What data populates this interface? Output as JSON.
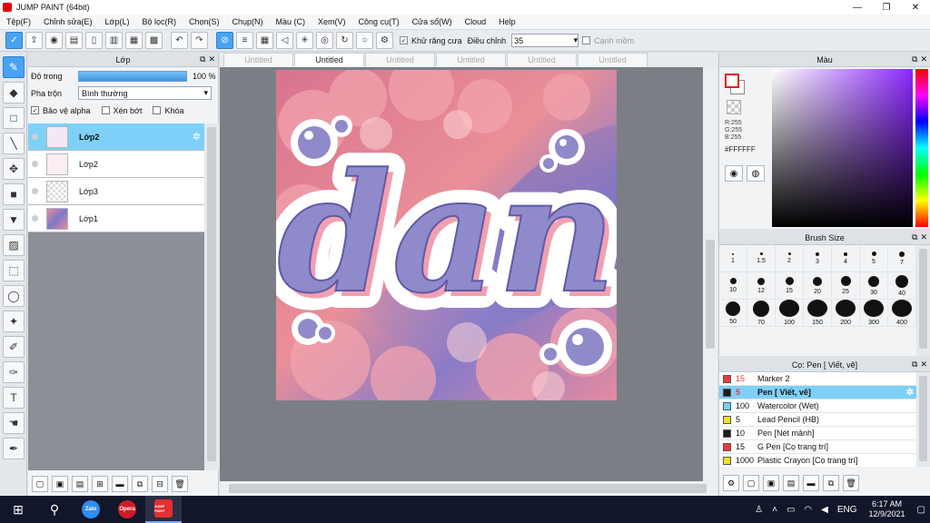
{
  "window": {
    "title": "JUMP PAINT (64bit)",
    "minimize": "—",
    "maximize": "❐",
    "close": "✕"
  },
  "menu": [
    "Tệp(F)",
    "Chỉnh sửa(E)",
    "Lớp(L)",
    "Bộ lọc(R)",
    "Chọn(S)",
    "Chụp(N)",
    "Màu (C)",
    "Xem(V)",
    "Công cụ(T)",
    "Cửa sổ(W)",
    "Cloud",
    "Help"
  ],
  "toolbar": {
    "antialias_check": "✓",
    "antialias_label": "Khử răng cưa",
    "adjust_label": "Điều chỉnh",
    "adjust_value": "35",
    "edge_label": "Cạnh mềm"
  },
  "layers_panel": {
    "title": "Lớp",
    "opacity_label": "Độ trong",
    "opacity_value": "100 %",
    "blend_label": "Pha trộn",
    "blend_value": "Bình thường",
    "protect_alpha_check": "✓",
    "protect_alpha": "Bảo vệ alpha",
    "clip": "Xén bớt",
    "lock": "Khóa",
    "layers": [
      {
        "name": "Lớp2",
        "selected": true
      },
      {
        "name": "Lớp2",
        "selected": false
      },
      {
        "name": "Lớp3",
        "selected": false
      },
      {
        "name": "Lớp1",
        "selected": false
      }
    ]
  },
  "doc_tabs": [
    "Untitled",
    "Untitled",
    "Untitled",
    "Untitled",
    "Untitled",
    "Untitled"
  ],
  "active_tab": 1,
  "canvas": {
    "lettering": "dan"
  },
  "color_panel": {
    "title": "Màu",
    "r": "R:255",
    "g": "G:255",
    "b": "B:255",
    "hex": "#FFFFFF",
    "fg_color": "#ffffff",
    "accent": "#e02020"
  },
  "brush_panel": {
    "title": "Brush Size",
    "sizes": [
      "1",
      "1.5",
      "2",
      "3",
      "4",
      "5",
      "7",
      "10",
      "12",
      "15",
      "20",
      "25",
      "30",
      "40",
      "50",
      "70",
      "100",
      "150",
      "200",
      "300",
      "400"
    ]
  },
  "tool_panel": {
    "title": "Cọ: Pen [ Viết, vẽ]",
    "items": [
      {
        "size": "15",
        "name": "Marker 2",
        "color": "#e83a3a",
        "red": true,
        "selected": false
      },
      {
        "size": "5",
        "name": "Pen [ Viết, vẽ]",
        "color": "#1c1c1c",
        "red": true,
        "selected": true
      },
      {
        "size": "100",
        "name": "Watercolor (Wet)",
        "color": "#6fd3f5",
        "red": false,
        "selected": false
      },
      {
        "size": "5",
        "name": "Lead Pencil (HB)",
        "color": "#f0e020",
        "red": false,
        "selected": false
      },
      {
        "size": "10",
        "name": "Pen [Nét mảnh]",
        "color": "#1c1c1c",
        "red": false,
        "selected": false
      },
      {
        "size": "15",
        "name": "G Pen [Cọ trang trí]",
        "color": "#e83a3a",
        "red": false,
        "selected": false
      },
      {
        "size": "1000",
        "name": "Plastic Crayon [Cọ trang trí]",
        "color": "#f0e020",
        "red": false,
        "selected": false
      }
    ]
  },
  "taskbar": {
    "apps": [
      "Zalo",
      "Opera",
      "JUMP PAINT"
    ],
    "lang": "ENG",
    "time": "6:17 AM",
    "date": "12/9/2021"
  }
}
